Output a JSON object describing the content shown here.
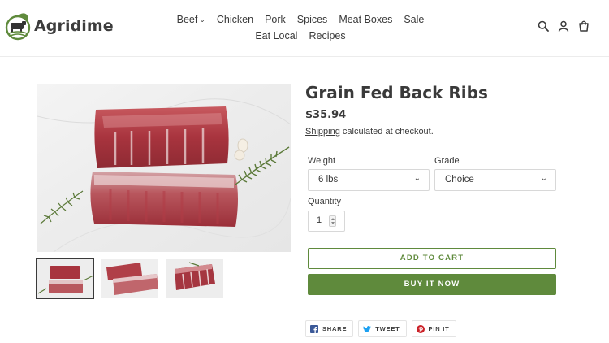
{
  "brand": {
    "name": "Agridime"
  },
  "nav": {
    "row1": [
      "Beef",
      "Chicken",
      "Pork",
      "Spices",
      "Meat Boxes",
      "Sale"
    ],
    "row2": [
      "Eat Local",
      "Recipes"
    ]
  },
  "header_icons": [
    "search-icon",
    "account-icon",
    "cart-icon"
  ],
  "product": {
    "title": "Grain Fed Back Ribs",
    "price": "$35.94",
    "shipping_link": "Shipping",
    "shipping_rest": " calculated at checkout.",
    "weight_label": "Weight",
    "weight_value": "6 lbs",
    "grade_label": "Grade",
    "grade_value": "Choice",
    "quantity_label": "Quantity",
    "quantity_value": "1",
    "add_to_cart": "ADD TO CART",
    "buy_now": "BUY IT NOW"
  },
  "share": {
    "facebook": "SHARE",
    "twitter": "TWEET",
    "pinterest": "PIN IT"
  },
  "colors": {
    "accent": "#5f8a3c",
    "text": "#3a3a3a",
    "facebook": "#3b5998",
    "twitter": "#1da1f2",
    "pinterest": "#cb2027"
  }
}
